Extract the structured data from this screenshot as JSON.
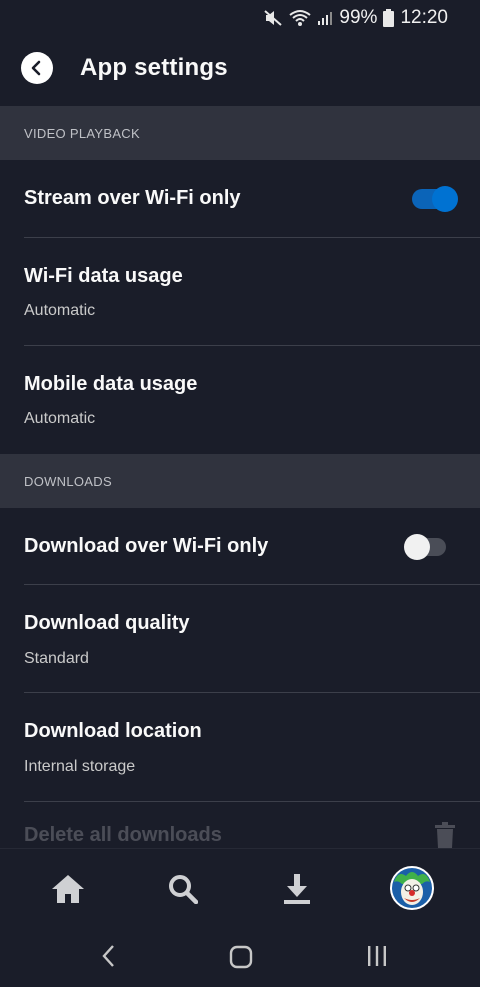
{
  "status_bar": {
    "battery": "99%",
    "time": "12:20",
    "icons": [
      "mute-icon",
      "wifi-icon",
      "signal-icon",
      "battery-icon"
    ]
  },
  "header": {
    "title": "App settings",
    "back_icon": "back-arrow-icon"
  },
  "sections": {
    "video_playback": {
      "label": "VIDEO PLAYBACK",
      "stream_wifi": {
        "title": "Stream over Wi-Fi only",
        "enabled": true
      },
      "wifi_usage": {
        "title": "Wi-Fi data usage",
        "value": "Automatic"
      },
      "mobile_usage": {
        "title": "Mobile data usage",
        "value": "Automatic"
      }
    },
    "downloads": {
      "label": "DOWNLOADS",
      "download_wifi": {
        "title": "Download over Wi-Fi only",
        "enabled": false
      },
      "quality": {
        "title": "Download quality",
        "value": "Standard"
      },
      "location": {
        "title": "Download location",
        "value": "Internal storage"
      },
      "delete_all": {
        "title": "Delete all downloads",
        "icon": "trash-icon"
      }
    }
  },
  "bottom_nav": {
    "items": [
      "home-icon",
      "search-icon",
      "download-icon",
      "profile-avatar"
    ]
  },
  "colors": {
    "background": "#1a1d29",
    "section_bg": "#30333e",
    "accent": "#0072d2"
  }
}
